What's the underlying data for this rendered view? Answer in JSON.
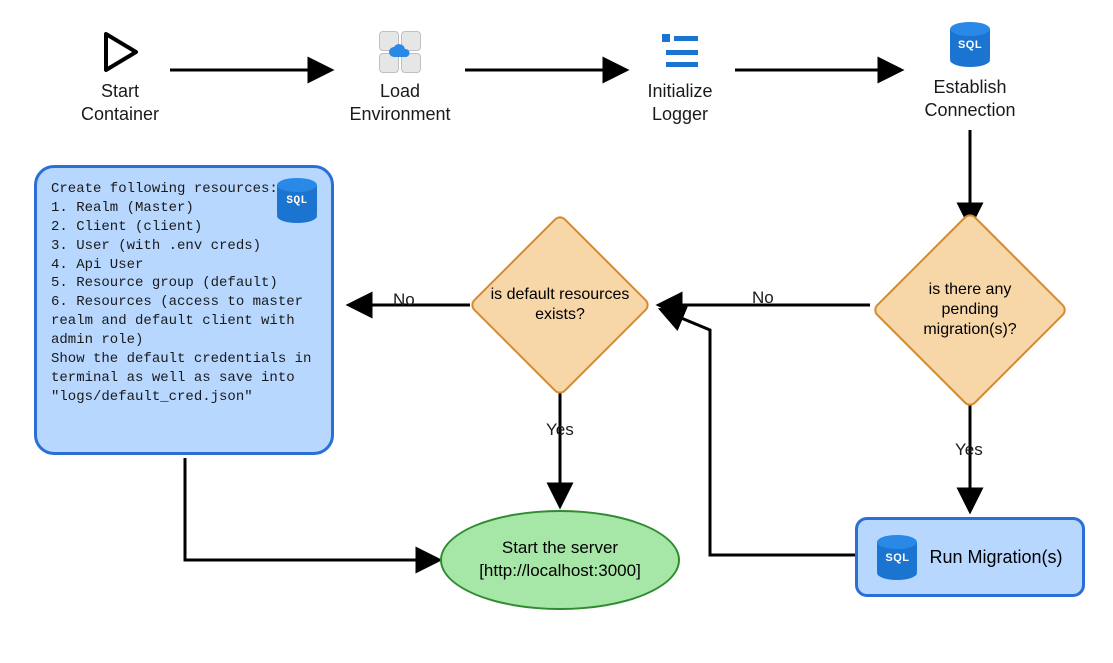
{
  "nodes": {
    "start": {
      "label1": "Start",
      "label2": "Container"
    },
    "load_env": {
      "label1": "Load",
      "label2": "Environment"
    },
    "init_logger": {
      "label1": "Initialize",
      "label2": "Logger"
    },
    "establish_conn": {
      "label1": "Establish",
      "label2": "Connection"
    },
    "decision_default": {
      "text": "is default resources exists?"
    },
    "decision_pending": {
      "text": "is there any pending migration(s)?"
    },
    "server": {
      "line1": "Start the server",
      "line2": "[http://localhost:3000]"
    },
    "run_migrations": {
      "label": "Run Migration(s)"
    }
  },
  "resources": {
    "header": "Create following resources:",
    "items": [
      "1. Realm (Master)",
      "2. Client (client)",
      "3. User (with .env creds)",
      "4. Api User",
      "5. Resource group (default)",
      "6. Resources (access to master realm and default client with admin role)"
    ],
    "footer": "Show the default credentials in terminal as well as save into \"logs/default_cred.json\""
  },
  "edge_labels": {
    "default_no": "No",
    "default_yes": "Yes",
    "pending_no": "No",
    "pending_yes": "Yes"
  },
  "icons": {
    "sql_label": "SQL"
  }
}
